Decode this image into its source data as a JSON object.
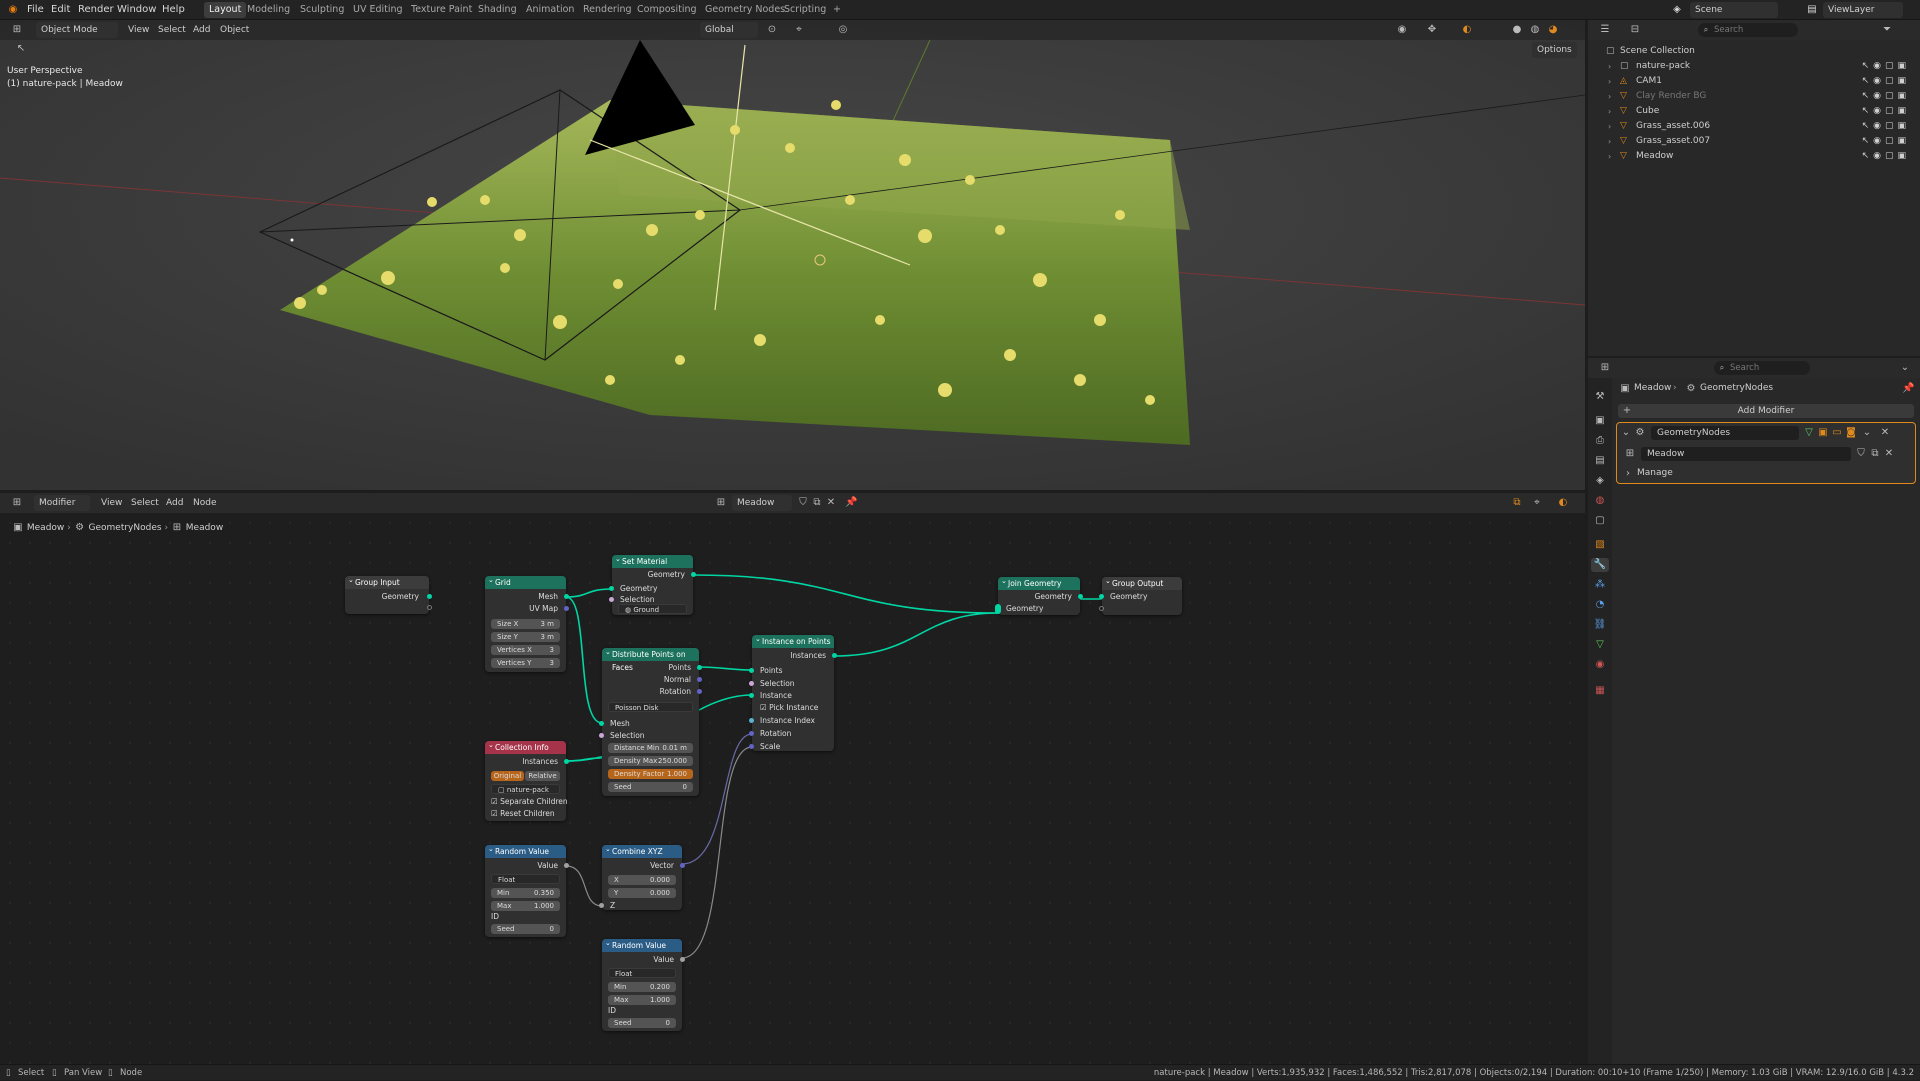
{
  "topbar": {
    "menus": [
      "File",
      "Edit",
      "Render",
      "Window",
      "Help"
    ],
    "workspaces": [
      "Layout",
      "Modeling",
      "Sculpting",
      "UV Editing",
      "Texture Paint",
      "Shading",
      "Animation",
      "Rendering",
      "Compositing",
      "Geometry Nodes",
      "Scripting"
    ],
    "active_workspace": "Layout",
    "add_tab": "+",
    "scene": "Scene",
    "view_layer": "ViewLayer"
  },
  "viewport": {
    "mode": "Object Mode",
    "menus": [
      "View",
      "Select",
      "Add",
      "Object"
    ],
    "orientation": "Global",
    "options": "Options",
    "info_line1": "User Perspective",
    "info_line2": "(1) nature-pack | Meadow"
  },
  "outliner": {
    "search_placeholder": "Search",
    "root": "Scene Collection",
    "items": [
      {
        "name": "nature-pack",
        "icon": "collection-icon",
        "dim": false
      },
      {
        "name": "CAM1",
        "icon": "camera-icon",
        "dim": false
      },
      {
        "name": "Clay Render BG",
        "icon": "mesh-icon",
        "dim": true
      },
      {
        "name": "Cube",
        "icon": "mesh-icon",
        "dim": false
      },
      {
        "name": "Grass_asset.006",
        "icon": "mesh-icon",
        "dim": false
      },
      {
        "name": "Grass_asset.007",
        "icon": "mesh-icon",
        "dim": false
      },
      {
        "name": "Meadow",
        "icon": "mesh-icon",
        "dim": false
      }
    ]
  },
  "properties": {
    "search_placeholder": "Search",
    "breadcrumb_object": "Meadow",
    "breadcrumb_modifier": "GeometryNodes",
    "add_modifier": "Add Modifier",
    "modifier_name": "GeometryNodes",
    "node_group": "Meadow",
    "manage": "Manage"
  },
  "node_editor": {
    "editor_type": "Modifier",
    "menus": [
      "View",
      "Select",
      "Add",
      "Node"
    ],
    "node_group": "Meadow",
    "breadcrumb": [
      "Meadow",
      "GeometryNodes",
      "Meadow"
    ],
    "nodes": {
      "group_input": {
        "title": "Group Input",
        "out": "Geometry"
      },
      "grid": {
        "title": "Grid",
        "out_mesh": "Mesh",
        "out_uv": "UV Map",
        "size_x_label": "Size X",
        "size_x": "3 m",
        "size_y_label": "Size Y",
        "size_y": "3 m",
        "vx_label": "Vertices X",
        "vx": "3",
        "vy_label": "Vertices Y",
        "vy": "3"
      },
      "set_material": {
        "title": "Set Material",
        "out": "Geometry",
        "in_geo": "Geometry",
        "in_sel": "Selection",
        "material": "Ground"
      },
      "distribute": {
        "title": "Distribute Points on Faces",
        "out_points": "Points",
        "out_normal": "Normal",
        "out_rotation": "Rotation",
        "mode": "Poisson Disk",
        "in_mesh": "Mesh",
        "in_sel": "Selection",
        "dmin_label": "Distance Min",
        "dmin": "0.01 m",
        "dmax_label": "Density Max",
        "dmax": "250.000",
        "dfac_label": "Density Factor",
        "dfac": "1.000",
        "seed_label": "Seed",
        "seed": "0"
      },
      "instance": {
        "title": "Instance on Points",
        "out": "Instances",
        "in_points": "Points",
        "in_sel": "Selection",
        "in_inst": "Instance",
        "pick": "Pick Instance",
        "in_idx": "Instance Index",
        "in_rot": "Rotation",
        "in_scale": "Scale"
      },
      "collection_info": {
        "title": "Collection Info",
        "out": "Instances",
        "btn_original": "Original",
        "btn_relative": "Relative",
        "collection": "nature-pack",
        "sep": "Separate Children",
        "reset": "Reset Children"
      },
      "random1": {
        "title": "Random Value",
        "out": "Value",
        "type": "Float",
        "min_label": "Min",
        "min": "0.350",
        "max_label": "Max",
        "max": "1.000",
        "id": "ID",
        "seed_label": "Seed",
        "seed": "0"
      },
      "combine": {
        "title": "Combine XYZ",
        "out": "Vector",
        "x_label": "X",
        "x": "0.000",
        "y_label": "Y",
        "y": "0.000",
        "z": "Z"
      },
      "random2": {
        "title": "Random Value",
        "out": "Value",
        "type": "Float",
        "min_label": "Min",
        "min": "0.200",
        "max_label": "Max",
        "max": "1.000",
        "id": "ID",
        "seed_label": "Seed",
        "seed": "0"
      },
      "join": {
        "title": "Join Geometry",
        "out": "Geometry",
        "in": "Geometry"
      },
      "group_output": {
        "title": "Group Output",
        "in": "Geometry"
      }
    }
  },
  "statusbar": {
    "hints": [
      "Select",
      "Pan View",
      "Node"
    ],
    "stats": "nature-pack | Meadow | Verts:1,935,932 | Faces:1,486,552 | Tris:2,817,078 | Objects:0/2,194 | Duration: 00:10+10 (Frame 1/250) | Memory: 1.03 GiB | VRAM: 12.9/16.0 GiB | 4.3.2"
  },
  "colors": {
    "geometry_socket": "#00d6a3",
    "geometry_header": "#1d725e",
    "accent": "#4772b3",
    "modifier_border": "#e08a1e"
  }
}
